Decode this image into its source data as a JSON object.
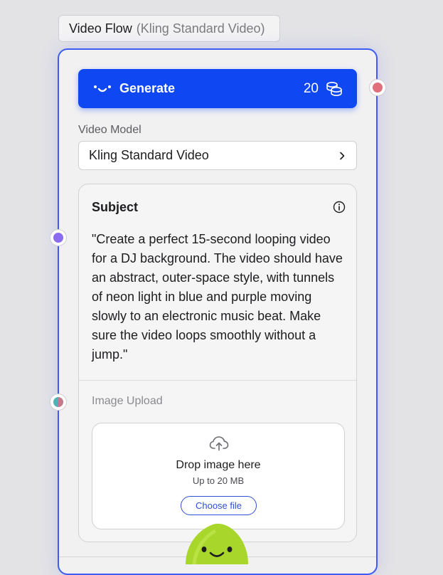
{
  "header": {
    "title": "Video Flow",
    "subtitle": "(Kling Standard Video)"
  },
  "generate": {
    "label": "Generate",
    "cost": "20",
    "icon": "smile-icon",
    "cost_icon": "coins-icon"
  },
  "video_model": {
    "label": "Video Model",
    "value": "Kling Standard Video"
  },
  "subject": {
    "title": "Subject",
    "text": "\"Create a perfect 15-second looping video for a DJ background. The video should have an abstract, outer-space style, with tunnels of neon light in blue and purple moving slowly to an electronic music beat. Make sure the video loops smoothly without a jump.\""
  },
  "image_upload": {
    "label": "Image Upload",
    "drop_title": "Drop image here",
    "drop_subtitle": "Up to 20 MB",
    "choose_label": "Choose file"
  },
  "colors": {
    "accent": "#0f47f2",
    "border": "#3d5cf2",
    "output_handle": "#e0707c",
    "subject_handle": "#8b6cf0",
    "mascot": "#a8d62a"
  }
}
